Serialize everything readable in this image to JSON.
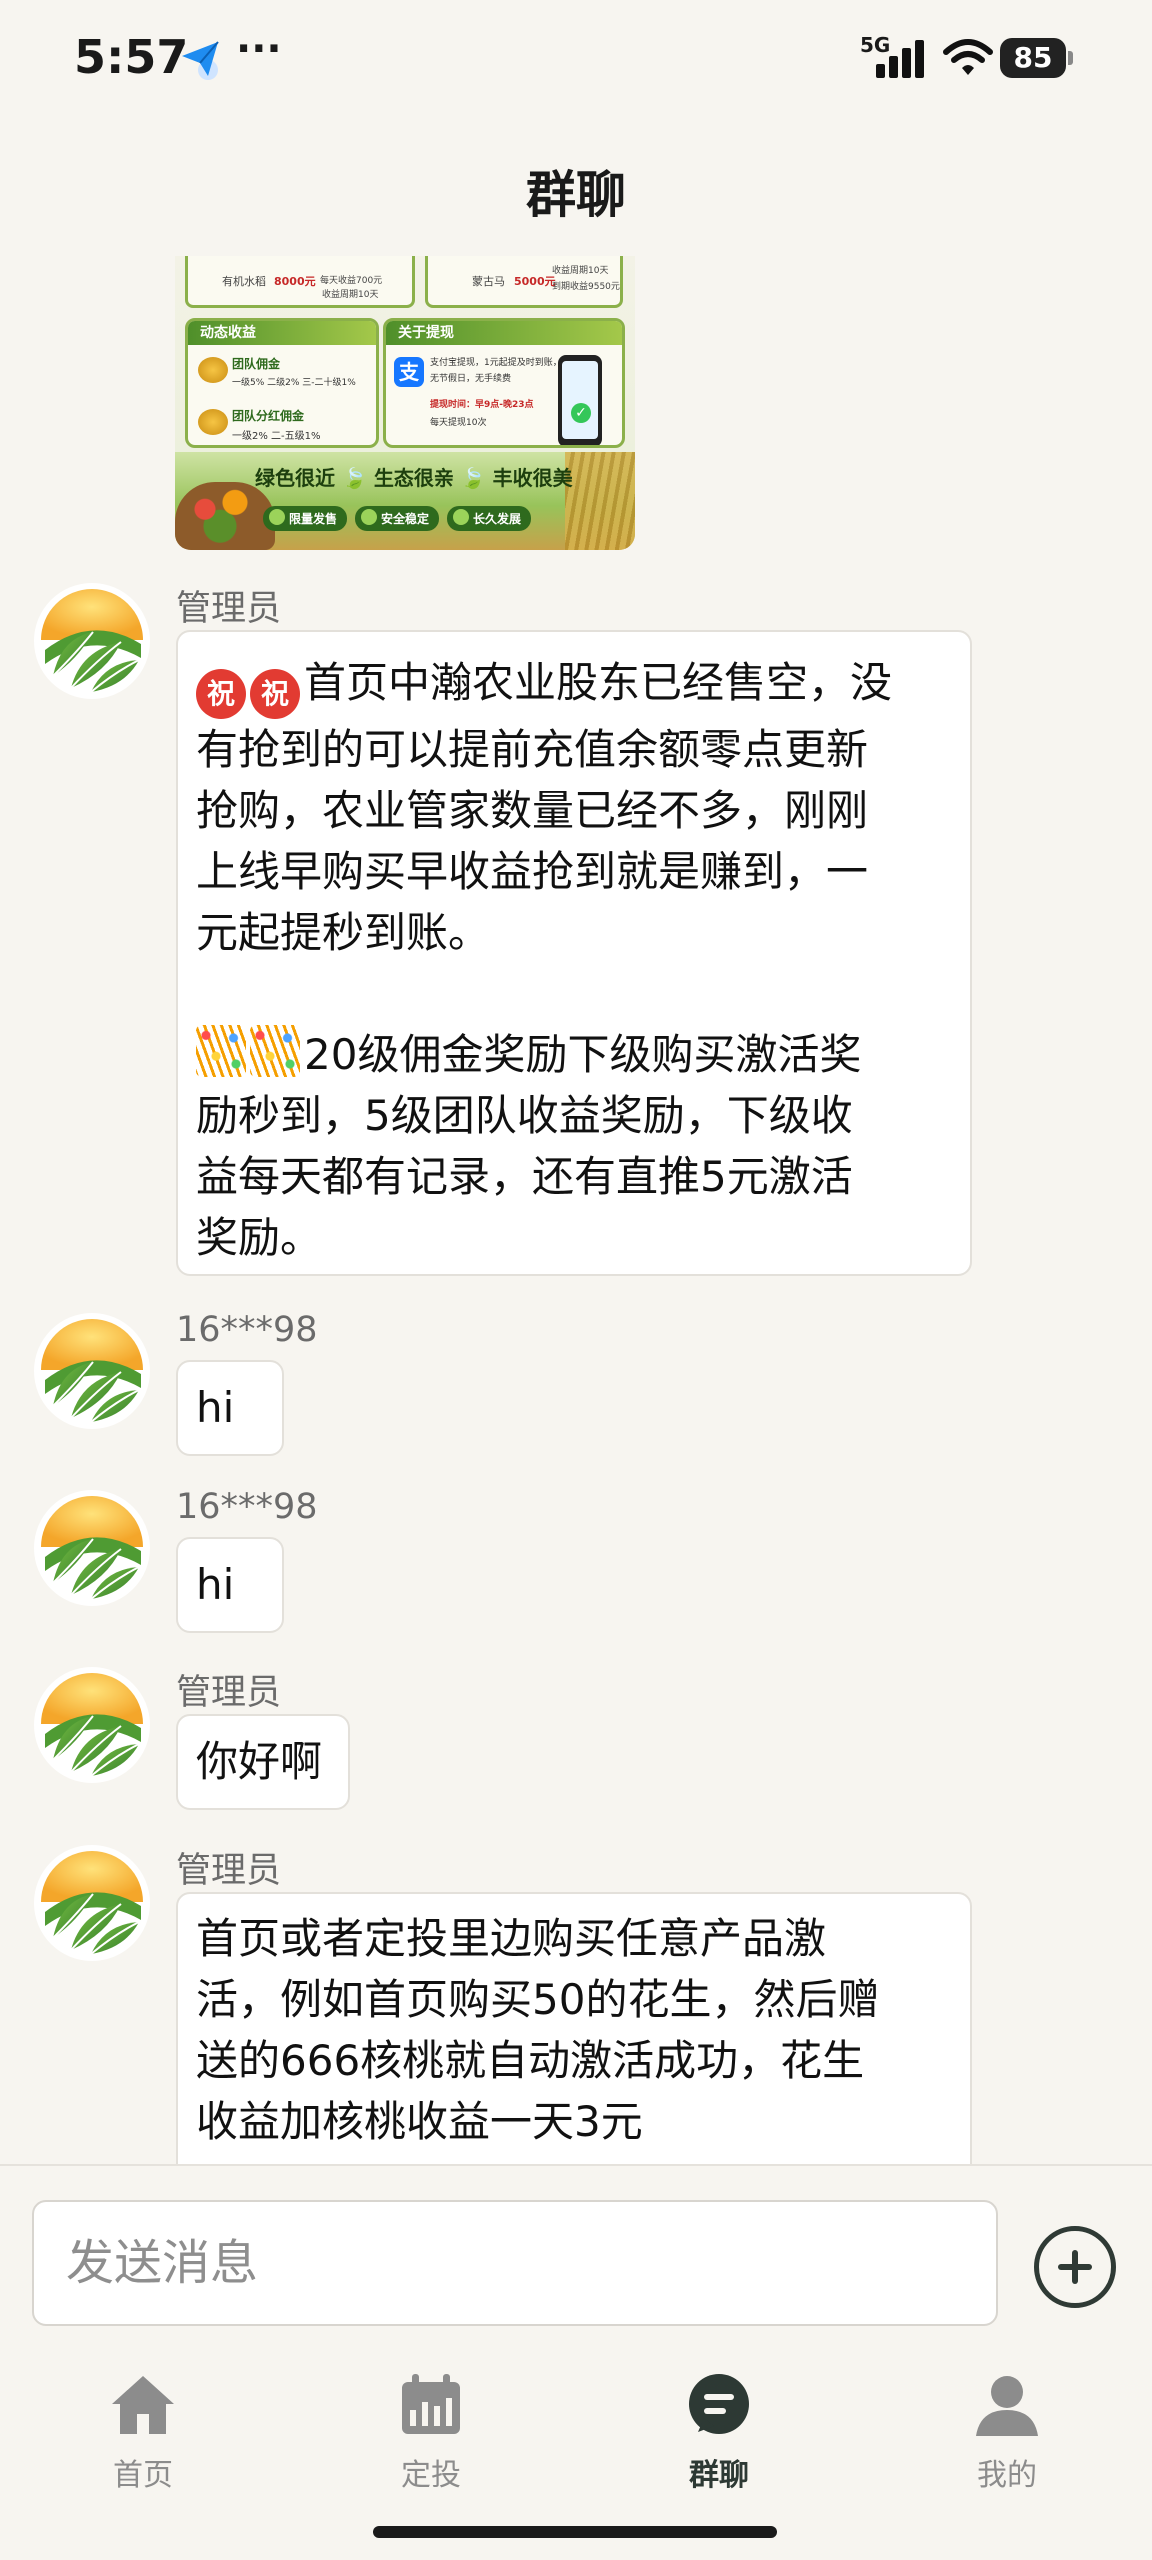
{
  "status": {
    "time": "5:57",
    "network": "5G",
    "battery": "85"
  },
  "header": {
    "title": "群聊"
  },
  "promo": {
    "top_line_a": "有机水稻",
    "top_price_a": "8000元",
    "top_daily_a": "每天收益700元",
    "top_period_a": "收益周期10天",
    "top_line_b": "蒙古马",
    "top_price_b": "5000元",
    "top_detail_b": "收益周期10天",
    "top_total_b": "到期收益9550元",
    "dynamic_title": "动态收益",
    "team_commission": "团队佣金",
    "team_commission_rates": "一级5%   二级2%   三-二十级1%",
    "team_dividend": "团队分红佣金",
    "team_dividend_rates": "一级2%   二-五级1%",
    "withdraw_title": "关于提现",
    "withdraw_line1": "支付宝提现，1元起提及时到账，",
    "withdraw_line2": "无节假日，无手续费",
    "withdraw_time": "提现时间：早9点-晚23点",
    "withdraw_times": "每天提现10次",
    "slogan": "绿色很近 🍃 生态很亲 🍃 丰收很美",
    "badges": [
      "限量发售",
      "安全稳定",
      "长久发展"
    ]
  },
  "messages": [
    {
      "sender": "管理员",
      "lines_a": "首页中瀚农业股东已经售空，没\n有抢到的可以提前充值余额零点更新\n抢购，农业管家数量已经不多，刚刚\n上线早购买早收益抢到就是赚到，一\n元起提秒到账。",
      "lines_b": "20级佣金奖励下级购买激活奖\n励秒到，5级团队收益奖励，下级收\n益每天都有记录，还有直推5元激活\n奖励。",
      "emoji_zhu": "祝"
    },
    {
      "sender": "16***98",
      "text": "hi"
    },
    {
      "sender": "16***98",
      "text": "hi"
    },
    {
      "sender": "管理员",
      "text": "你好啊"
    },
    {
      "sender": "管理员",
      "text": "首页或者定投里边购买任意产品激\n活，例如首页购买50的花生，然后赠\n送的666核桃就自动激活成功，花生\n收益加核桃收益一天3元"
    }
  ],
  "composer": {
    "placeholder": "发送消息"
  },
  "tabs": [
    {
      "label": "首页",
      "icon": "home-icon",
      "active": false
    },
    {
      "label": "定投",
      "icon": "calendar-icon",
      "active": false
    },
    {
      "label": "群聊",
      "icon": "chat-icon",
      "active": true
    },
    {
      "label": "我的",
      "icon": "user-icon",
      "active": false
    }
  ],
  "colors": {
    "background": "#f7f5f0",
    "bubble": "#ffffff",
    "accent_active": "#2d3934",
    "tab_inactive": "#8c8c8c"
  }
}
